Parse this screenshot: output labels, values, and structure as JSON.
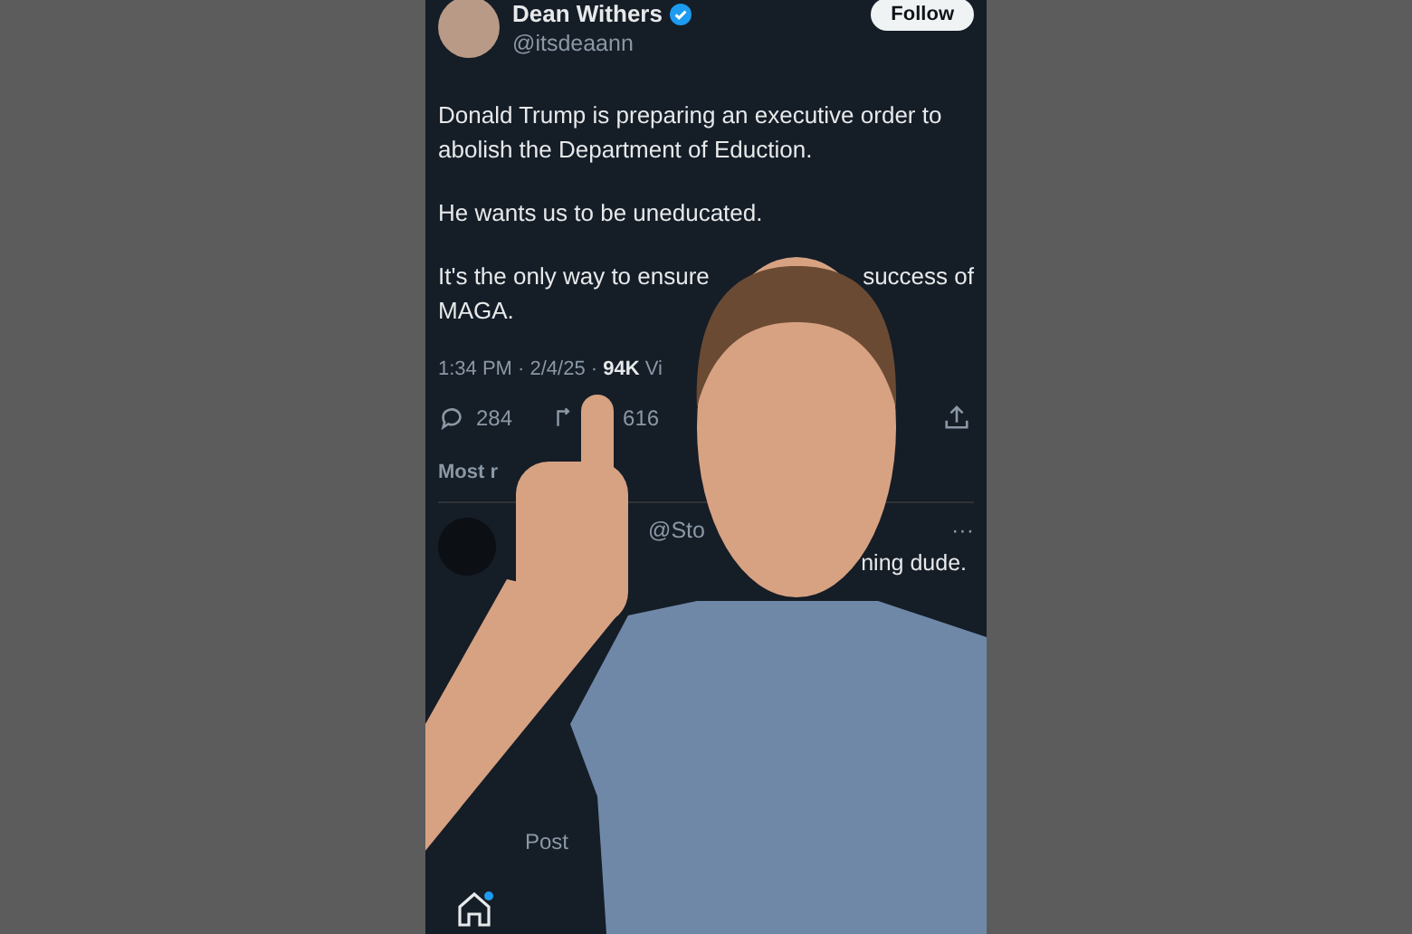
{
  "author": {
    "name": "Dean Withers",
    "handle": "@itsdeaann",
    "follow": "Follow"
  },
  "tweet": {
    "paragraphs": [
      "Donald Trump is preparing an executive order to abolish the Department of Eduction.",
      "He wants us to be uneducated."
    ],
    "partial_line": [
      "It's the only way to ensure",
      "success of"
    ],
    "last_line": "MAGA."
  },
  "meta": "1:34 PM · 2/4/25 · **94K** Vi",
  "actions": {
    "replies": "284",
    "reposts": "616"
  },
  "sort": "Most r",
  "reply": {
    "handle": "@Sto",
    "more": "···",
    "text_fragment": "ning dude."
  },
  "compose": {
    "placeholder": "Post"
  }
}
